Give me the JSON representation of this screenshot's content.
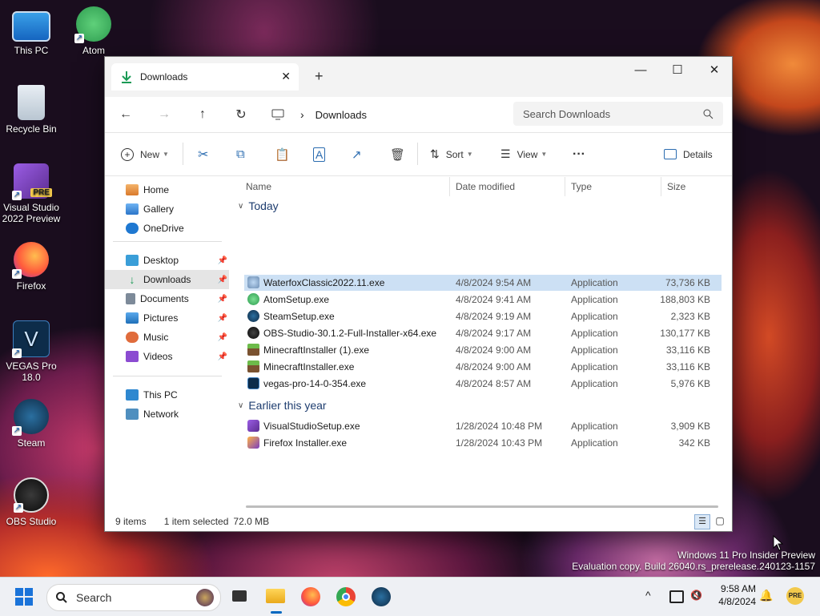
{
  "desktop": {
    "icons": [
      {
        "label": "This PC"
      },
      {
        "label": "Atom"
      },
      {
        "label": "Recycle Bin"
      },
      {
        "label": "Visual Studio 2022 Preview",
        "badge": "PRE"
      },
      {
        "label": "Firefox"
      },
      {
        "label": "VEGAS Pro 18.0"
      },
      {
        "label": "Steam"
      },
      {
        "label": "OBS Studio"
      }
    ],
    "watermark_line1": "Windows 11 Pro Insider Preview",
    "watermark_line2": "Evaluation copy. Build 26040.rs_prerelease.240123-1157"
  },
  "window": {
    "tab_title": "Downloads",
    "tab_close": "✕",
    "new_tab": "+",
    "controls": {
      "minimize": "—",
      "maximize": "☐",
      "close": "✕"
    },
    "nav": {
      "back": "←",
      "forward": "→",
      "up": "↑",
      "refresh": "↻"
    },
    "breadcrumb": {
      "separator": "›",
      "current": "Downloads"
    },
    "search": {
      "placeholder": "Search Downloads"
    },
    "toolbar": {
      "new_label": "New",
      "sort_label": "Sort",
      "view_label": "View",
      "more_label": "···",
      "details_label": "Details"
    },
    "sidebar": {
      "home": "Home",
      "gallery": "Gallery",
      "onedrive": "OneDrive",
      "desktop": "Desktop",
      "downloads": "Downloads",
      "documents": "Documents",
      "pictures": "Pictures",
      "music": "Music",
      "videos": "Videos",
      "thispc": "This PC",
      "network": "Network"
    },
    "columns": {
      "name": "Name",
      "date": "Date modified",
      "type": "Type",
      "size": "Size"
    },
    "groups": {
      "today": "Today",
      "earlier": "Earlier this year"
    },
    "files": [
      {
        "name": "WaterfoxClassic2022.11.exe",
        "date": "4/8/2024 9:54 AM",
        "type": "Application",
        "size": "73,736 KB"
      },
      {
        "name": "AtomSetup.exe",
        "date": "4/8/2024 9:41 AM",
        "type": "Application",
        "size": "188,803 KB"
      },
      {
        "name": "SteamSetup.exe",
        "date": "4/8/2024 9:19 AM",
        "type": "Application",
        "size": "2,323 KB"
      },
      {
        "name": "OBS-Studio-30.1.2-Full-Installer-x64.exe",
        "date": "4/8/2024 9:17 AM",
        "type": "Application",
        "size": "130,177 KB"
      },
      {
        "name": "MinecraftInstaller (1).exe",
        "date": "4/8/2024 9:00 AM",
        "type": "Application",
        "size": "33,116 KB"
      },
      {
        "name": "MinecraftInstaller.exe",
        "date": "4/8/2024 9:00 AM",
        "type": "Application",
        "size": "33,116 KB"
      },
      {
        "name": "vegas-pro-14-0-354.exe",
        "date": "4/8/2024 8:57 AM",
        "type": "Application",
        "size": "5,976 KB"
      },
      {
        "name": "VisualStudioSetup.exe",
        "date": "1/28/2024 10:48 PM",
        "type": "Application",
        "size": "3,909 KB"
      },
      {
        "name": "Firefox Installer.exe",
        "date": "1/28/2024 10:43 PM",
        "type": "Application",
        "size": "342 KB"
      }
    ],
    "status": {
      "count": "9 items",
      "selection": "1 item selected",
      "selection_size": "72.0 MB"
    }
  },
  "taskbar": {
    "search_label": "Search",
    "time": "9:58 AM",
    "date": "4/8/2024",
    "chevron": "^"
  },
  "colors": {
    "accent": "#0067c0",
    "selected_row": "#cce0f4",
    "selected_nav": "#e5e5e5"
  }
}
